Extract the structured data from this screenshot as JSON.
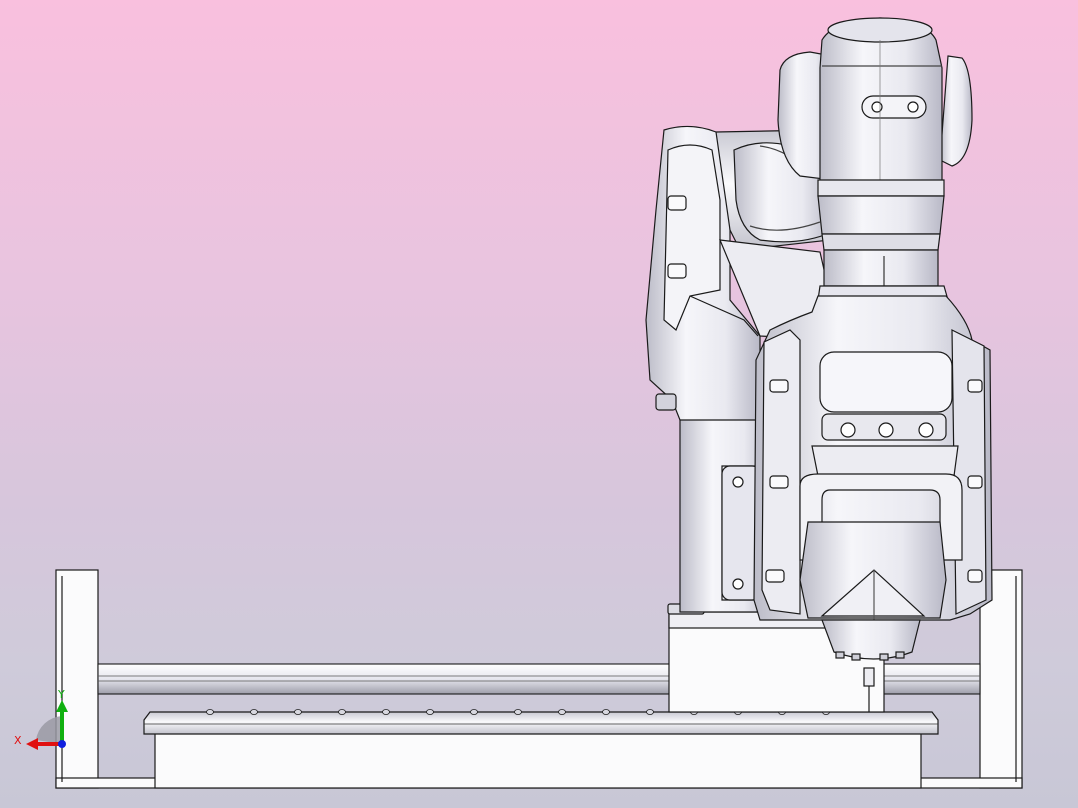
{
  "viewport": {
    "background_top": "#f9c0de",
    "background_bottom": "#c8c7d6"
  },
  "model": {
    "parts": [
      "frame",
      "rail",
      "fixture-plate",
      "robot-base",
      "robot-arm",
      "end-effector"
    ]
  },
  "triad": {
    "x_label": "X",
    "y_label": "Y",
    "x_color": "#e01010",
    "y_color": "#10b010",
    "z_color": "#1020e0"
  },
  "colors": {
    "part_fill": "#f4f4f8",
    "part_shade": "#c8c8d4",
    "edge": "#1a1a1a"
  }
}
